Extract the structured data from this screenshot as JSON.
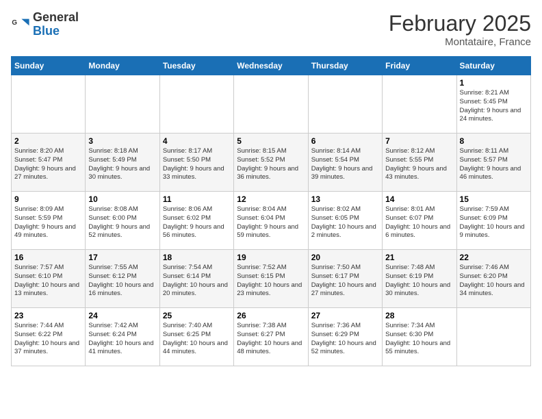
{
  "logo": {
    "general": "General",
    "blue": "Blue"
  },
  "header": {
    "title": "February 2025",
    "location": "Montataire, France"
  },
  "days_of_week": [
    "Sunday",
    "Monday",
    "Tuesday",
    "Wednesday",
    "Thursday",
    "Friday",
    "Saturday"
  ],
  "weeks": [
    [
      {
        "day": "",
        "info": ""
      },
      {
        "day": "",
        "info": ""
      },
      {
        "day": "",
        "info": ""
      },
      {
        "day": "",
        "info": ""
      },
      {
        "day": "",
        "info": ""
      },
      {
        "day": "",
        "info": ""
      },
      {
        "day": "1",
        "info": "Sunrise: 8:21 AM\nSunset: 5:45 PM\nDaylight: 9 hours and 24 minutes."
      }
    ],
    [
      {
        "day": "2",
        "info": "Sunrise: 8:20 AM\nSunset: 5:47 PM\nDaylight: 9 hours and 27 minutes."
      },
      {
        "day": "3",
        "info": "Sunrise: 8:18 AM\nSunset: 5:49 PM\nDaylight: 9 hours and 30 minutes."
      },
      {
        "day": "4",
        "info": "Sunrise: 8:17 AM\nSunset: 5:50 PM\nDaylight: 9 hours and 33 minutes."
      },
      {
        "day": "5",
        "info": "Sunrise: 8:15 AM\nSunset: 5:52 PM\nDaylight: 9 hours and 36 minutes."
      },
      {
        "day": "6",
        "info": "Sunrise: 8:14 AM\nSunset: 5:54 PM\nDaylight: 9 hours and 39 minutes."
      },
      {
        "day": "7",
        "info": "Sunrise: 8:12 AM\nSunset: 5:55 PM\nDaylight: 9 hours and 43 minutes."
      },
      {
        "day": "8",
        "info": "Sunrise: 8:11 AM\nSunset: 5:57 PM\nDaylight: 9 hours and 46 minutes."
      }
    ],
    [
      {
        "day": "9",
        "info": "Sunrise: 8:09 AM\nSunset: 5:59 PM\nDaylight: 9 hours and 49 minutes."
      },
      {
        "day": "10",
        "info": "Sunrise: 8:08 AM\nSunset: 6:00 PM\nDaylight: 9 hours and 52 minutes."
      },
      {
        "day": "11",
        "info": "Sunrise: 8:06 AM\nSunset: 6:02 PM\nDaylight: 9 hours and 56 minutes."
      },
      {
        "day": "12",
        "info": "Sunrise: 8:04 AM\nSunset: 6:04 PM\nDaylight: 9 hours and 59 minutes."
      },
      {
        "day": "13",
        "info": "Sunrise: 8:02 AM\nSunset: 6:05 PM\nDaylight: 10 hours and 2 minutes."
      },
      {
        "day": "14",
        "info": "Sunrise: 8:01 AM\nSunset: 6:07 PM\nDaylight: 10 hours and 6 minutes."
      },
      {
        "day": "15",
        "info": "Sunrise: 7:59 AM\nSunset: 6:09 PM\nDaylight: 10 hours and 9 minutes."
      }
    ],
    [
      {
        "day": "16",
        "info": "Sunrise: 7:57 AM\nSunset: 6:10 PM\nDaylight: 10 hours and 13 minutes."
      },
      {
        "day": "17",
        "info": "Sunrise: 7:55 AM\nSunset: 6:12 PM\nDaylight: 10 hours and 16 minutes."
      },
      {
        "day": "18",
        "info": "Sunrise: 7:54 AM\nSunset: 6:14 PM\nDaylight: 10 hours and 20 minutes."
      },
      {
        "day": "19",
        "info": "Sunrise: 7:52 AM\nSunset: 6:15 PM\nDaylight: 10 hours and 23 minutes."
      },
      {
        "day": "20",
        "info": "Sunrise: 7:50 AM\nSunset: 6:17 PM\nDaylight: 10 hours and 27 minutes."
      },
      {
        "day": "21",
        "info": "Sunrise: 7:48 AM\nSunset: 6:19 PM\nDaylight: 10 hours and 30 minutes."
      },
      {
        "day": "22",
        "info": "Sunrise: 7:46 AM\nSunset: 6:20 PM\nDaylight: 10 hours and 34 minutes."
      }
    ],
    [
      {
        "day": "23",
        "info": "Sunrise: 7:44 AM\nSunset: 6:22 PM\nDaylight: 10 hours and 37 minutes."
      },
      {
        "day": "24",
        "info": "Sunrise: 7:42 AM\nSunset: 6:24 PM\nDaylight: 10 hours and 41 minutes."
      },
      {
        "day": "25",
        "info": "Sunrise: 7:40 AM\nSunset: 6:25 PM\nDaylight: 10 hours and 44 minutes."
      },
      {
        "day": "26",
        "info": "Sunrise: 7:38 AM\nSunset: 6:27 PM\nDaylight: 10 hours and 48 minutes."
      },
      {
        "day": "27",
        "info": "Sunrise: 7:36 AM\nSunset: 6:29 PM\nDaylight: 10 hours and 52 minutes."
      },
      {
        "day": "28",
        "info": "Sunrise: 7:34 AM\nSunset: 6:30 PM\nDaylight: 10 hours and 55 minutes."
      },
      {
        "day": "",
        "info": ""
      }
    ]
  ]
}
